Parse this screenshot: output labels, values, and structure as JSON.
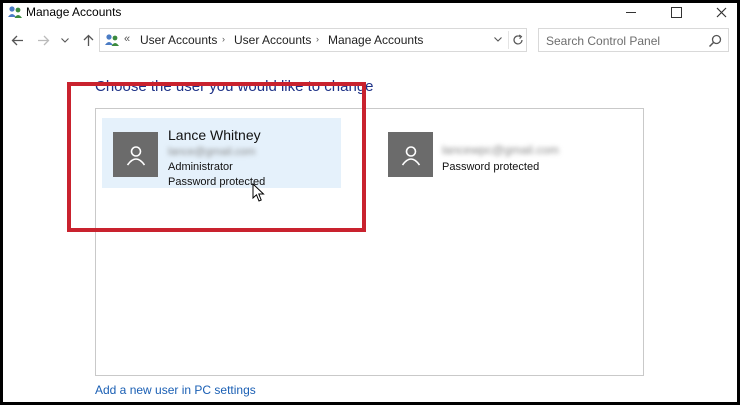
{
  "window": {
    "title": "Manage Accounts",
    "icons": {
      "app": "users-icon",
      "minimize": "minimize-icon",
      "maximize": "maximize-icon",
      "close": "close-icon"
    }
  },
  "nav": {
    "back_icon": "back-arrow-icon",
    "forward_icon": "forward-arrow-icon",
    "recent_icon": "chevron-down-icon",
    "up_icon": "up-arrow-icon",
    "address": {
      "overflow": "«",
      "breadcrumbs": [
        "User Accounts",
        "User Accounts",
        "Manage Accounts"
      ],
      "separator": "›",
      "dropdown_icon": "chevron-down-icon",
      "refresh_icon": "refresh-icon"
    },
    "search": {
      "placeholder": "Search Control Panel",
      "icon": "search-icon"
    }
  },
  "content": {
    "heading": "Choose the user you would like to change",
    "accounts": [
      {
        "name": "Lance Whitney",
        "email": "lance@gmail.com",
        "role": "Administrator",
        "status": "Password protected",
        "selected": true,
        "icon": "user-avatar-icon"
      },
      {
        "name": "",
        "email": "lancewpc@gmail.com",
        "role": "",
        "status": "Password protected",
        "selected": false,
        "icon": "user-avatar-icon"
      }
    ],
    "add_user_link": "Add a new user in PC settings"
  },
  "colors": {
    "heading": "#1e3287",
    "link": "#1a5fb4",
    "selected_tile": "#e5f1fb",
    "avatar": "#6b6b6b",
    "highlight_box": "#c9222e"
  }
}
